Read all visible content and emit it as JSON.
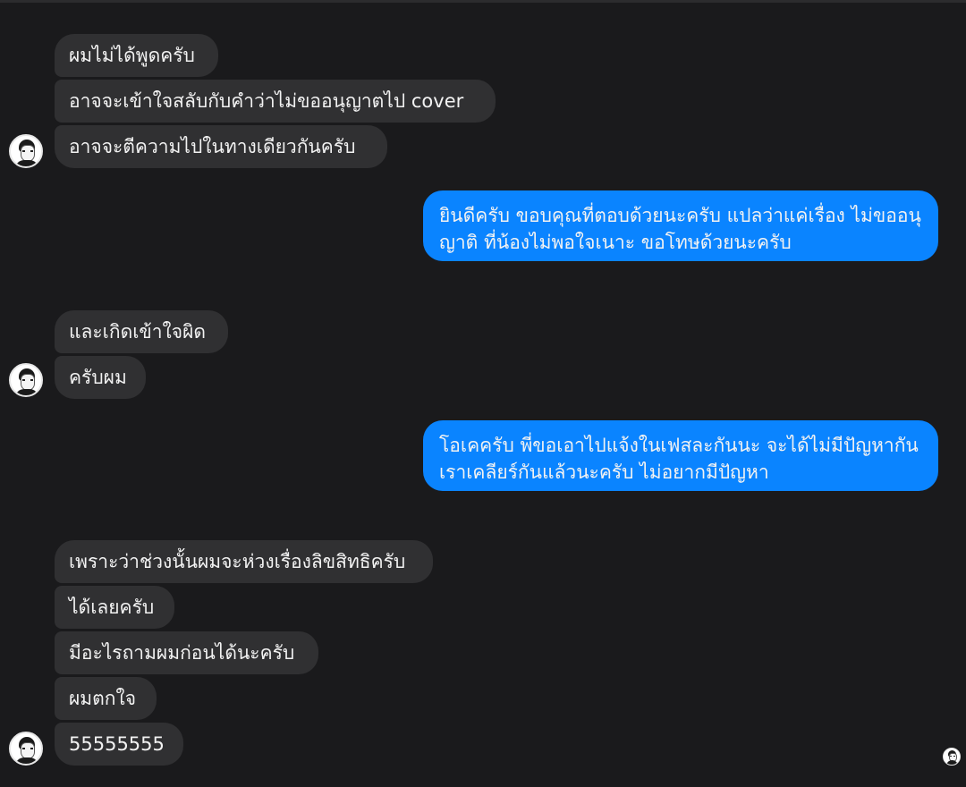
{
  "messages": {
    "group1": [
      "ผมไม่ได้พูดครับ",
      "อาจจะเข้าใจสลับกับคำว่าไม่ขออนุญาตไป cover",
      "อาจจะตีความไปในทางเดียวกันครับ"
    ],
    "outgoing1": "ยินดีครับ ขอบคุณที่ตอบด้วยนะครับ แปลว่าแค่เรื่อง ไม่ขออนุญาติ ที่น้องไม่พอใจเนาะ ขอโทษด้วยนะครับ",
    "group2": [
      "และเกิดเข้าใจผิด",
      "ครับผม"
    ],
    "outgoing2": "โอเคครับ พี่ขอเอาไปแจ้งในเฟสละกันนะ จะได้ไม่มีปัญหากัน เราเคลียร์กันแล้วนะครับ ไม่อยากมีปัญหา",
    "group3": [
      "เพราะว่าช่วงนั้นผมจะห่วงเรื่องลิขสิทธิครับ",
      "ได้เลยครับ",
      "มีอะไรถามผมก่อนได้นะครับ",
      "ผมตกใจ",
      "55555555"
    ]
  },
  "colors": {
    "background": "#1a1a1c",
    "incoming_bubble": "#303032",
    "outgoing_bubble": "#0a84ff",
    "text": "#f2f2f2"
  },
  "icons": {
    "contact_avatar": "contact-avatar-icon",
    "read_receipt": "seen-avatar-icon"
  }
}
